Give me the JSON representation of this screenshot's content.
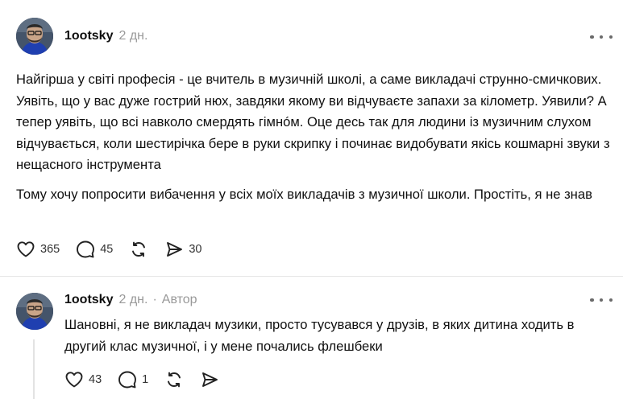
{
  "post": {
    "username": "1ootsky",
    "time": "2 дн.",
    "paragraphs": [
      "Найгірша у світі професія - це вчитель в музичній школі, а саме викладачі струнно-смичкових. Уявіть, що у вас дуже гострий нюх, завдяки якому ви відчуваєте запахи за кілометр. Уявили? А тепер уявіть, що всі навколо смердять гімнóм. Оце десь так для людини із музичним слухом відчувається, коли шестирічка бере в руки скрипку і починає видобувати якісь кошмарні звуки з нещасного інструмента",
      "Тому хочу попросити вибачення у всіх моїх викладачів з музичної школи. Простіть, я не знав"
    ],
    "actions": {
      "likes": "365",
      "comments": "45",
      "shares": "30"
    },
    "icons": {
      "like": "heart-icon",
      "comment": "comment-icon",
      "repost": "repost-icon",
      "share": "send-icon",
      "more": "more-icon"
    }
  },
  "reply": {
    "username": "1ootsky",
    "time": "2 дн.",
    "separator": "·",
    "author_label": "Автор",
    "text": "Шановні, я не викладач музики, просто тусувався у друзів, в яких дитина ходить в другий клас музичної, і у мене почались флешбеки",
    "actions": {
      "likes": "43",
      "comments": "1"
    }
  },
  "colors": {
    "text": "#101010",
    "muted": "#999999",
    "divider": "#e5e5e5"
  }
}
